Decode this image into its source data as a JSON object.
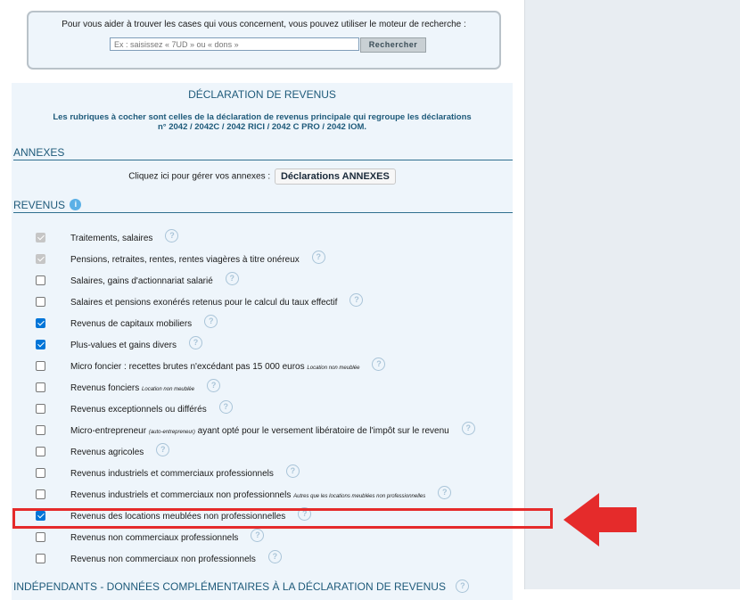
{
  "search": {
    "instruction": "Pour vous aider à trouver les cases qui vous concernent, vous pouvez utiliser le moteur de recherche :",
    "placeholder": "Ex : saisissez « 7UD » ou « dons »",
    "button_label": "Rechercher"
  },
  "declaration": {
    "title": "DÉCLARATION DE REVENUS",
    "subtitle_line1": "Les rubriques à cocher sont celles de la déclaration de revenus principale qui regroupe les déclarations",
    "subtitle_line2": "n° 2042 / 2042C / 2042 RICI / 2042 C PRO / 2042 IOM."
  },
  "annexes": {
    "heading": "ANNEXES",
    "prompt": "Cliquez ici pour gérer vos annexes :",
    "button_label": "Déclarations ANNEXES"
  },
  "revenus": {
    "heading": "REVENUS",
    "help_glyph": "?",
    "items": [
      {
        "label": "Traitements, salaires",
        "note": "",
        "state": "disabled"
      },
      {
        "label": "Pensions, retraites, rentes, rentes viagères à titre onéreux",
        "note": "",
        "state": "disabled"
      },
      {
        "label": "Salaires, gains d'actionnariat salarié",
        "note": "",
        "state": "unchecked"
      },
      {
        "label": "Salaires et pensions exonérés retenus pour le calcul du taux effectif",
        "note": "",
        "state": "unchecked"
      },
      {
        "label": "Revenus de capitaux mobiliers",
        "note": "",
        "state": "checked"
      },
      {
        "label": "Plus-values et gains divers",
        "note": "",
        "state": "checked"
      },
      {
        "label": "Micro foncier : recettes brutes n'excédant pas 15 000 euros",
        "note": "Location non meublée",
        "state": "unchecked"
      },
      {
        "label": "Revenus fonciers",
        "note": "Location non meublée",
        "state": "unchecked"
      },
      {
        "label": "Revenus exceptionnels ou différés",
        "note": "",
        "state": "unchecked"
      },
      {
        "label": "Micro-entrepreneur",
        "note": "(auto-entrepreneur)",
        "label_after": " ayant opté pour le versement libératoire de l'impôt sur le revenu",
        "state": "unchecked"
      },
      {
        "label": "Revenus agricoles",
        "note": "",
        "state": "unchecked"
      },
      {
        "label": "Revenus industriels et commerciaux professionnels",
        "note": "",
        "state": "unchecked"
      },
      {
        "label": "Revenus industriels et commerciaux non professionnels",
        "note": "Autres que les locations meublées non professionnelles",
        "state": "unchecked"
      },
      {
        "label": "Revenus des locations meublées non professionnelles",
        "note": "",
        "state": "checked"
      },
      {
        "label": "Revenus non commerciaux professionnels",
        "note": "",
        "state": "unchecked"
      },
      {
        "label": "Revenus non commerciaux non professionnels",
        "note": "",
        "state": "unchecked"
      }
    ]
  },
  "bottom_section": {
    "heading": "INDÉPENDANTS - DONNÉES COMPLÉMENTAIRES À LA DÉCLARATION DE REVENUS"
  },
  "colors": {
    "accent": "#1e5a7a",
    "highlight": "#e52b2b",
    "checkbox_checked": "#0075d8"
  }
}
